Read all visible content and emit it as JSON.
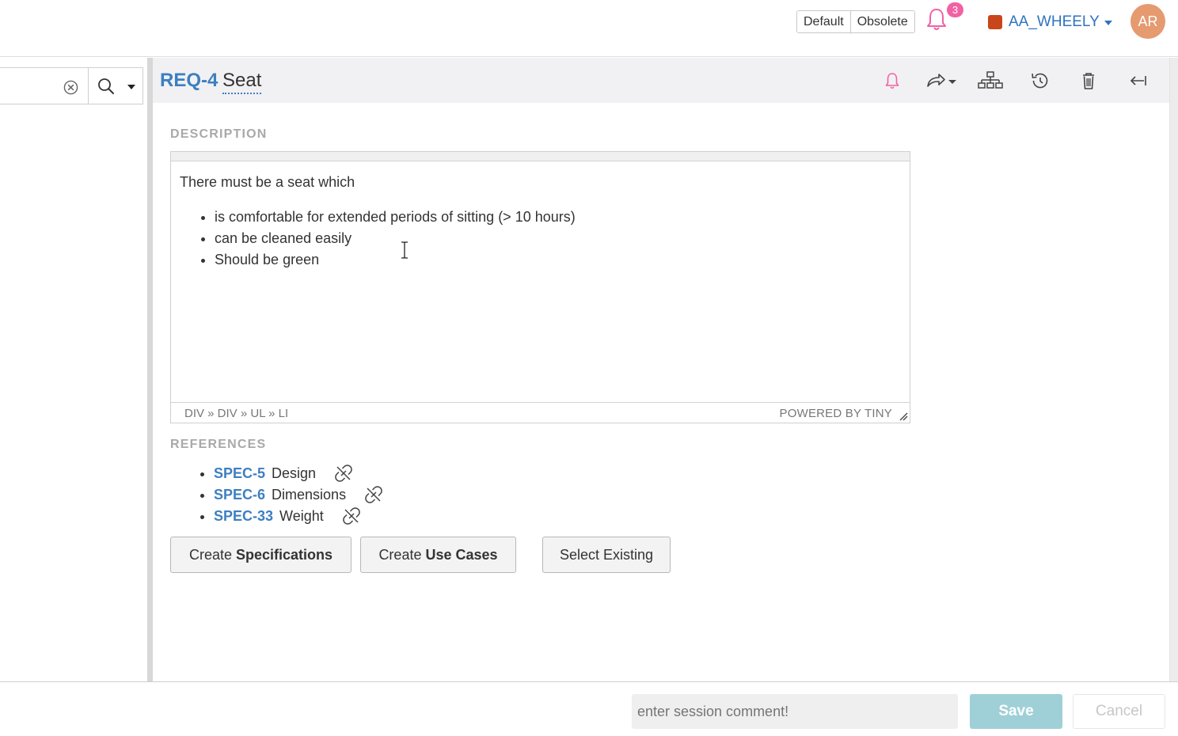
{
  "topbar": {
    "tags": [
      "Default",
      "Obsolete"
    ],
    "notification_count": "3",
    "project": {
      "name": "AA_WHEELY",
      "color": "#c9451a"
    },
    "avatar_initials": "AR"
  },
  "search": {
    "value": ""
  },
  "item": {
    "id": "REQ-4",
    "title": "Seat",
    "description_label": "DESCRIPTION",
    "description": {
      "intro": "There must be a seat which",
      "bullets": [
        "is comfortable for extended periods of sitting (> 10 hours)",
        "can be cleaned easily",
        "Should be green"
      ]
    },
    "editor_path": "DIV » DIV » UL » LI",
    "editor_branding": "POWERED BY TINY",
    "references_label": "REFERENCES",
    "references": [
      {
        "id": "SPEC-5",
        "name": "Design"
      },
      {
        "id": "SPEC-6",
        "name": "Dimensions"
      },
      {
        "id": "SPEC-33",
        "name": "Weight"
      }
    ]
  },
  "actions": {
    "create_spec": {
      "prefix": "Create",
      "bold": "Specifications"
    },
    "create_uc": {
      "prefix": "Create",
      "bold": "Use Cases"
    },
    "select_existing": "Select Existing"
  },
  "bottombar": {
    "session_placeholder": "enter session comment!",
    "save": "Save",
    "cancel": "Cancel"
  },
  "colors": {
    "accent": "#3d7fc1",
    "notification": "#f261a4",
    "save": "#9fd0d7"
  }
}
